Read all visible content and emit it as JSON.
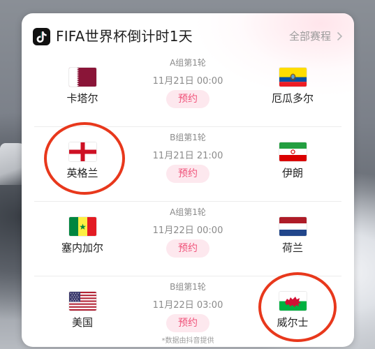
{
  "widget": {
    "title": "FIFA世界杯倒计时1天",
    "all_link": "全部赛程",
    "footnote": "*数据由抖音提供"
  },
  "matches": [
    {
      "round": "A组第1轮",
      "time": "11月21日 00:00",
      "button": "预约",
      "home": {
        "name": "卡塔尔",
        "flag": "qatar-flag"
      },
      "away": {
        "name": "厄瓜多尔",
        "flag": "ecuador-flag"
      }
    },
    {
      "round": "B组第1轮",
      "time": "11月21日 21:00",
      "button": "预约",
      "home": {
        "name": "英格兰",
        "flag": "england-flag"
      },
      "away": {
        "name": "伊朗",
        "flag": "iran-flag"
      }
    },
    {
      "round": "A组第1轮",
      "time": "11月22日 00:00",
      "button": "预约",
      "home": {
        "name": "塞内加尔",
        "flag": "senegal-flag"
      },
      "away": {
        "name": "荷兰",
        "flag": "netherlands-flag"
      }
    },
    {
      "round": "B组第1轮",
      "time": "11月22日 03:00",
      "button": "预约",
      "home": {
        "name": "美国",
        "flag": "usa-flag"
      },
      "away": {
        "name": "威尔士",
        "flag": "wales-flag"
      }
    }
  ],
  "colors": {
    "accent_text": "#f0537a",
    "accent_bg": "#fde8ee",
    "annotation_circle": "#e8381c"
  }
}
